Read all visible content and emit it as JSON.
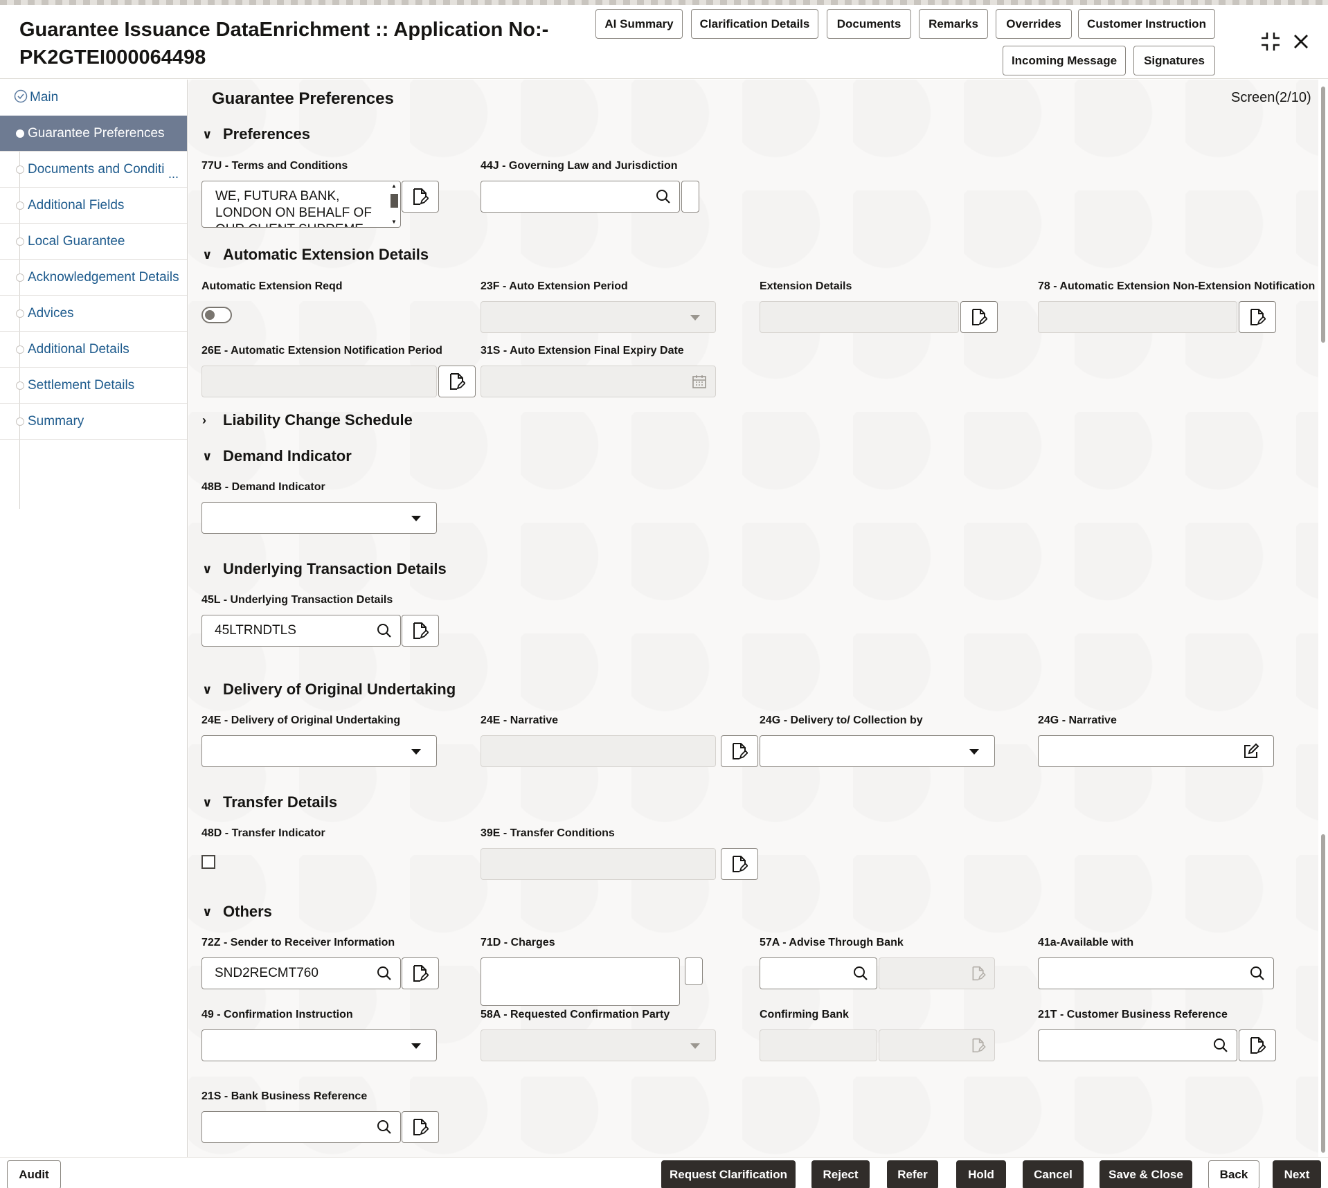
{
  "header": {
    "title_line1": "Guarantee Issuance DataEnrichment :: Application No:-",
    "title_line2": "PK2GTEI000064498",
    "buttons": [
      "AI Summary",
      "Clarification Details",
      "Documents",
      "Remarks",
      "Overrides",
      "Customer Instruction",
      "Incoming Message",
      "Signatures"
    ]
  },
  "sidebar": {
    "items": [
      "Main",
      "Guarantee Preferences",
      "Documents and Conditi",
      "Additional Fields",
      "Local Guarantee",
      "Acknowledgement Details",
      "Advices",
      "Additional Details",
      "Settlement Details",
      "Summary"
    ],
    "ellipsis": "..."
  },
  "main": {
    "page_title": "Guarantee Preferences",
    "screen": "Screen(2/10)",
    "sections": {
      "preferences": "Preferences",
      "auto_ext": "Automatic Extension Details",
      "liability": "Liability Change Schedule",
      "demand": "Demand Indicator",
      "underlying": "Underlying Transaction Details",
      "delivery": "Delivery of Original Undertaking",
      "transfer": "Transfer Details",
      "others": "Others"
    },
    "labels": {
      "terms": "77U - Terms and Conditions",
      "governing": "44J - Governing Law and Jurisdiction",
      "auto_ext_reqd": "Automatic Extension Reqd",
      "auto_ext_period": "23F - Auto Extension Period",
      "ext_details": "Extension Details",
      "non_ext_notif": "78 - Automatic Extension Non-Extension Notification",
      "notif_period": "26E - Automatic Extension Notification Period",
      "final_expiry": "31S - Auto Extension Final Expiry Date",
      "demand_ind": "48B - Demand Indicator",
      "underlying_txn": "45L - Underlying Transaction Details",
      "delivery_orig": "24E - Delivery of Original Undertaking",
      "narrative_24e": "24E - Narrative",
      "delivery_to": "24G - Delivery to/ Collection by",
      "narrative_24g": "24G - Narrative",
      "transfer_ind": "48D - Transfer Indicator",
      "transfer_cond": "39E - Transfer Conditions",
      "sender_receiver": "72Z - Sender to Receiver Information",
      "charges": "71D - Charges",
      "advise_bank": "57A - Advise Through Bank",
      "available_with": "41a-Available with",
      "confirmation": "49 - Confirmation Instruction",
      "req_conf_party": "58A - Requested Confirmation Party",
      "confirming_bank": "Confirming Bank",
      "cust_bus_ref": "21T - Customer Business Reference",
      "bank_bus_ref": "21S - Bank Business Reference"
    },
    "values": {
      "terms_line1": "WE, FUTURA BANK,",
      "terms_line2": "LONDON ON BEHALF OF",
      "terms_line3": "OUR CLIENT SUPREME",
      "underlying_txn": "45LTRNDTLS",
      "sender_receiver": "SND2RECMT760"
    }
  },
  "footer": {
    "audit": "Audit",
    "buttons": [
      "Request Clarification",
      "Reject",
      "Refer",
      "Hold",
      "Cancel",
      "Save & Close",
      "Back",
      "Next"
    ]
  }
}
